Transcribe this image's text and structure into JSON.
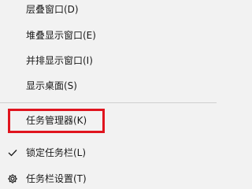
{
  "menu": {
    "items": [
      {
        "label": "层叠窗口(D)"
      },
      {
        "label": "堆叠显示窗口(E)"
      },
      {
        "label": "并排显示窗口(I)"
      },
      {
        "label": "显示桌面(S)"
      },
      {
        "label": "任务管理器(K)"
      },
      {
        "label": "锁定任务栏(L)",
        "icon": "checkmark-icon",
        "checked": true
      },
      {
        "label": "任务栏设置(T)",
        "icon": "gear-icon"
      }
    ]
  },
  "colors": {
    "menu_background": "#f2f2f2",
    "text": "#1a1a1a",
    "separator": "#cfcfcf",
    "highlight_border": "#e0141e"
  }
}
